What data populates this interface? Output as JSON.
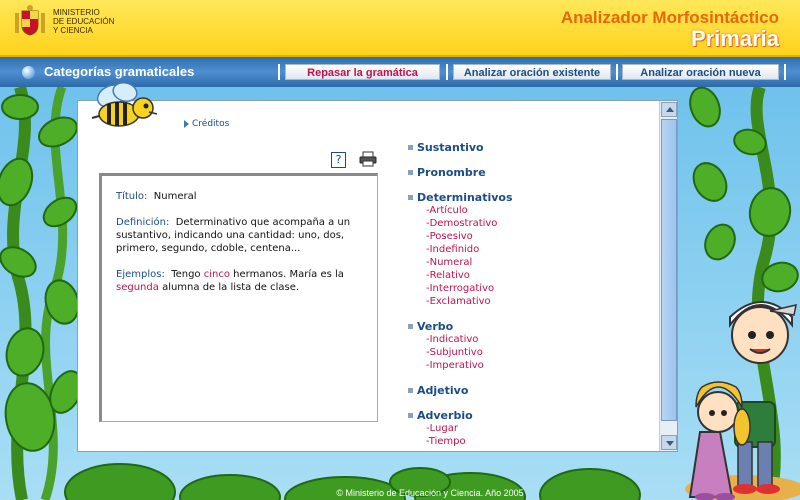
{
  "header": {
    "ministry_lines": [
      "MINISTERIO",
      "DE EDUCACIÓN",
      "Y CIENCIA"
    ],
    "app_title_line1": "Analizador Morfosintáctico",
    "app_title_line2": "Primaria"
  },
  "nav": {
    "section_title": "Categorías gramaticales",
    "buttons": [
      {
        "label": "Repasar la gramática",
        "active": true
      },
      {
        "label": "Analizar oración existente",
        "active": false
      },
      {
        "label": "Analizar oración nueva",
        "active": false
      }
    ]
  },
  "panel": {
    "credits_label": "Créditos",
    "help_label": "?",
    "definition": {
      "title_label": "Título:",
      "title_value": "Numeral",
      "def_label": "Definición:",
      "def_text": "Determinativo que acompaña a un sustantivo, indicando una cantidad: uno, dos, primero, segundo, cdoble, centena...",
      "examples_label": "Ejemplos:",
      "ex_pre": "Tengo",
      "ex_word1": "cinco",
      "ex_mid": "hermanos. María es la",
      "ex_word2": "segunda",
      "ex_post": "alumna de la lista de clase."
    },
    "categories": [
      {
        "label": "Sustantivo",
        "subs": []
      },
      {
        "label": "Pronombre",
        "subs": []
      },
      {
        "label": "Determinativos",
        "subs": [
          "-Artículo",
          "-Demostrativo",
          "-Posesivo",
          "-Indefinido",
          "-Numeral",
          "-Relativo",
          "-Interrogativo",
          "-Exclamativo"
        ]
      },
      {
        "label": "Verbo",
        "subs": [
          "-Indicativo",
          "-Subjuntivo",
          "-Imperativo"
        ]
      },
      {
        "label": "Adjetivo",
        "subs": []
      },
      {
        "label": "Adverbio",
        "subs": [
          "-Lugar",
          "-Tiempo"
        ]
      }
    ]
  },
  "footer": {
    "copyright": "© Ministerio de Educación y Ciencia. Año 2005"
  },
  "colors": {
    "header_yellow": "#ffd21c",
    "title_orange": "#e8670c",
    "nav_blue": "#2f6fae",
    "link_blue": "#1b4d86",
    "accent_magenta": "#c4114d",
    "sky": "#8fd0ef",
    "leaf_green": "#3f9a22"
  },
  "icons": [
    "spain-crest-icon",
    "bullet-icon",
    "bee-icon",
    "help-icon",
    "printer-icon",
    "scroll-up-icon",
    "scroll-down-icon"
  ]
}
